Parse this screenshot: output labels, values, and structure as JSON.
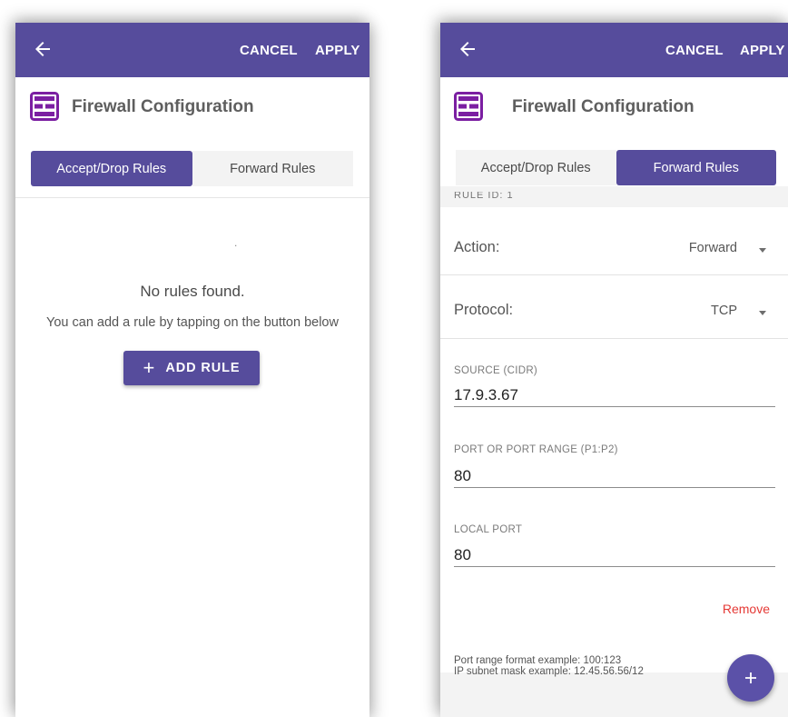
{
  "left_screen": {
    "appbar": {
      "cancel_label": "CANCEL",
      "apply_label": "APPLY"
    },
    "header": {
      "title": "Firewall Configuration",
      "icon": "firewall-icon"
    },
    "tabs": [
      {
        "label": "Accept/Drop Rules",
        "active": true
      },
      {
        "label": "Forward Rules",
        "active": false
      }
    ],
    "empty_state": {
      "indicator": ".",
      "title": "No rules found.",
      "subtitle": "You can add a rule by tapping on the button below",
      "add_button_label": "ADD RULE"
    }
  },
  "right_screen": {
    "appbar": {
      "cancel_label": "CANCEL",
      "apply_label": "APPLY"
    },
    "header": {
      "title": "Firewall Configuration",
      "icon": "firewall-icon"
    },
    "tabs": [
      {
        "label": "Accept/Drop Rules",
        "active": false
      },
      {
        "label": "Forward Rules",
        "active": true
      }
    ],
    "rule_header": "RULE ID: 1",
    "rule": {
      "action": {
        "label": "Action:",
        "value": "Forward"
      },
      "protocol": {
        "label": "Protocol:",
        "value": "TCP"
      },
      "source": {
        "label": "SOURCE (CIDR)",
        "value": "17.9.3.67"
      },
      "port_range": {
        "label": "PORT OR PORT RANGE (P1:P2)",
        "value": "80"
      },
      "local_port": {
        "label": "LOCAL PORT",
        "value": "80"
      },
      "remove_label": "Remove"
    },
    "notes": {
      "port_range_example": "Port range format example: 100:123",
      "subnet_example": "IP subnet mask example: 12.45.56.56/12"
    },
    "fab_icon": "plus-icon"
  },
  "colors": {
    "primary": "#564c9c",
    "firewall_icon": "#7b1fa2",
    "danger": "#e53935",
    "surface_gray": "#f3f3f3"
  }
}
